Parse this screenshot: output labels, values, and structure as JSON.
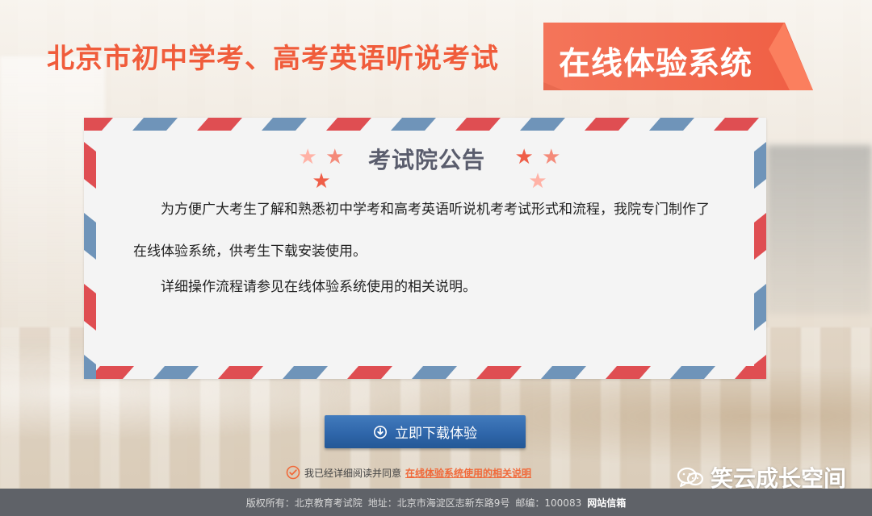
{
  "header": {
    "title": "北京市初中学考、高考英语听说考试",
    "ribbon_label": "在线体验系统"
  },
  "notice": {
    "title": "考试院公告",
    "stars": [
      "★",
      "★",
      "★"
    ],
    "paragraphs": [
      "为方便广大考生了解和熟悉初中学考和高考英语听说机考考试形式和流程，我院专门制作了在线体验系统，供考生下载安装使用。",
      "详细操作流程请参见在线体验系统使用的相关说明。"
    ]
  },
  "download": {
    "label": "立即下载体验",
    "icon": "download-circle-icon"
  },
  "agreement": {
    "text": "我已经详细阅读并同意",
    "link_label": "在线体验系统使用的相关说明",
    "icon": "check-circle-icon"
  },
  "watermark": {
    "label": "笑云成长空间",
    "icon": "wechat-icon"
  },
  "footer": {
    "copyright": "版权所有：北京教育考试院",
    "address": "地址：北京市海淀区志新东路9号",
    "postcode": "邮编：100083",
    "mailbox": "网站信箱"
  },
  "colors": {
    "title_orange": "#f05c3b",
    "ribbon_orange": "#f06a4d",
    "button_blue": "#2f66aa",
    "airmail_red": "#df4e52",
    "airmail_blue": "#6f94b9",
    "footer_gray": "#5f6268"
  }
}
